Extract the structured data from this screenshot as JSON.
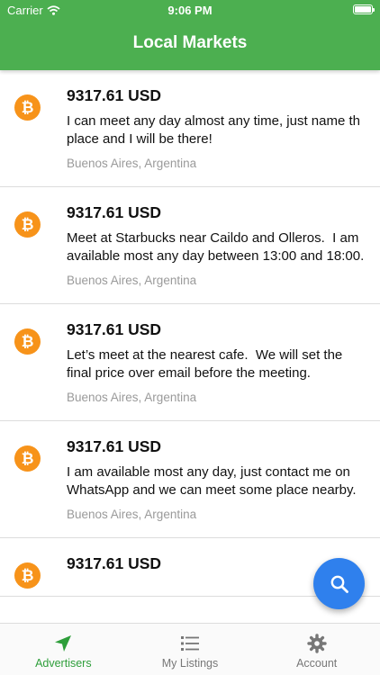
{
  "status_bar": {
    "carrier": "Carrier",
    "time": "9:06 PM",
    "signal_icon": "wifi-icon",
    "battery_icon": "battery-icon"
  },
  "header": {
    "title": "Local Markets"
  },
  "listings": [
    {
      "coin_icon": "bitcoin-icon",
      "coin_symbol": "₿",
      "price": "9317.61 USD",
      "description": "I can meet any day almost any time, just name th place and I will be there!",
      "location": "Buenos Aires, Argentina"
    },
    {
      "coin_icon": "bitcoin-icon",
      "coin_symbol": "₿",
      "price": "9317.61 USD",
      "description": "Meet at Starbucks near Caildo and Olleros.  I am available most any day between 13:00 and 18:00.",
      "location": "Buenos Aires, Argentina"
    },
    {
      "coin_icon": "bitcoin-icon",
      "coin_symbol": "₿",
      "price": "9317.61 USD",
      "description": "Let’s meet at the nearest cafe.  We will set the final price over email before the meeting.",
      "location": "Buenos Aires, Argentina"
    },
    {
      "coin_icon": "bitcoin-icon",
      "coin_symbol": "₿",
      "price": "9317.61 USD",
      "description": "I am available most any day, just contact me on WhatsApp and we can meet some place nearby.",
      "location": "Buenos Aires, Argentina"
    },
    {
      "coin_icon": "bitcoin-icon",
      "coin_symbol": "₿",
      "price": "9317.61 USD",
      "description": "",
      "location": ""
    }
  ],
  "fab": {
    "icon": "search-icon"
  },
  "tabs": [
    {
      "label": "Advertisers",
      "icon": "navigation-arrow-icon",
      "active": true
    },
    {
      "label": "My Listings",
      "icon": "list-icon",
      "active": false
    },
    {
      "label": "Account",
      "icon": "gear-icon",
      "active": false
    }
  ],
  "colors": {
    "header": "#4caf50",
    "bitcoin": "#f7931a",
    "fab": "#2f80ed",
    "active_tab": "#2e9e3a",
    "inactive_tab": "#777777",
    "location_text": "#9a9a9a"
  }
}
